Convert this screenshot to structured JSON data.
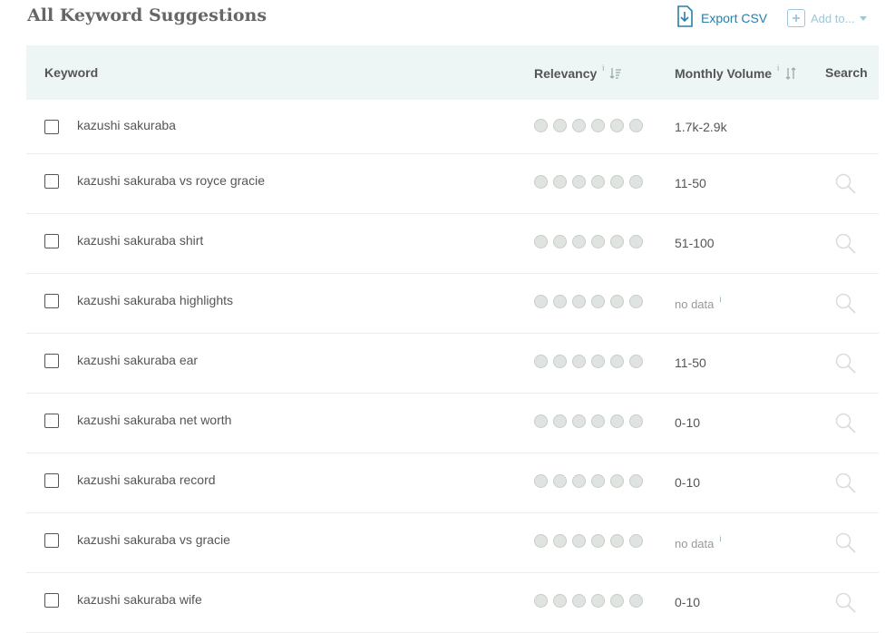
{
  "header": {
    "title": "All Keyword Suggestions",
    "export_label": "Export CSV",
    "addto_label": "Add to..."
  },
  "colors": {
    "accent": "#2a7ea8",
    "accent_light": "#9dc7d8",
    "header_bg": "#eef5f5"
  },
  "table": {
    "columns": {
      "keyword": "Keyword",
      "relevancy": "Relevancy",
      "volume": "Monthly Volume",
      "search": "Search",
      "info": "i"
    },
    "rows": [
      {
        "keyword": "kazushi sakuraba",
        "volume": "1.7k-2.9k",
        "has_search": false
      },
      {
        "keyword": "kazushi sakuraba vs royce gracie",
        "volume": "11-50",
        "has_search": true
      },
      {
        "keyword": "kazushi sakuraba shirt",
        "volume": "51-100",
        "has_search": true
      },
      {
        "keyword": "kazushi sakuraba highlights",
        "volume": "no data",
        "has_search": true
      },
      {
        "keyword": "kazushi sakuraba ear",
        "volume": "11-50",
        "has_search": true
      },
      {
        "keyword": "kazushi sakuraba net worth",
        "volume": "0-10",
        "has_search": true
      },
      {
        "keyword": "kazushi sakuraba record",
        "volume": "0-10",
        "has_search": true
      },
      {
        "keyword": "kazushi sakuraba vs gracie",
        "volume": "no data",
        "has_search": true
      },
      {
        "keyword": "kazushi sakuraba wife",
        "volume": "0-10",
        "has_search": true
      }
    ]
  },
  "icons": {
    "export": "download-file-icon",
    "addto": "plus-box-icon",
    "sort_relevancy": "sort-desc-icon",
    "sort_volume": "sort-icon",
    "search": "magnifier-icon"
  }
}
